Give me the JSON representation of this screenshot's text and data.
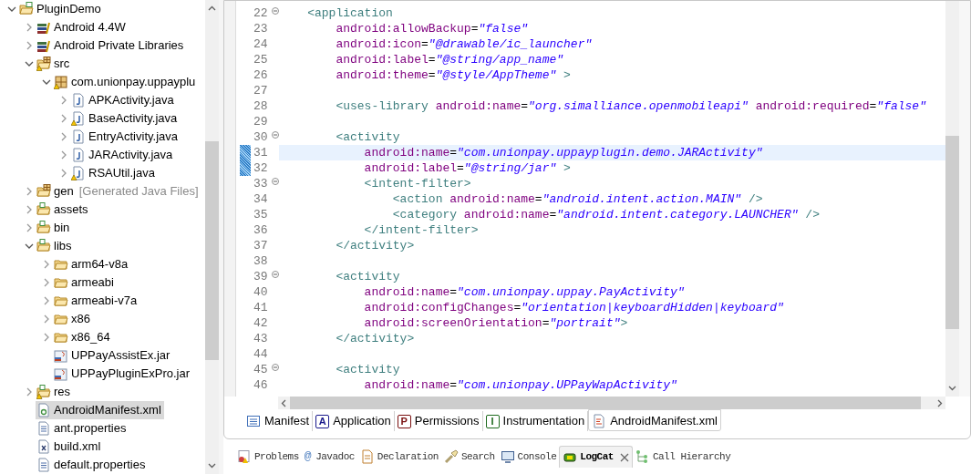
{
  "project_tree": [
    {
      "label": "PluginDemo",
      "kind": "project",
      "warning": false,
      "expanded": true,
      "selected": false,
      "children": [
        {
          "label": "Android 4.4W",
          "kind": "library",
          "warning": false,
          "expanded": false,
          "selected": false
        },
        {
          "label": "Android Private Libraries",
          "kind": "library",
          "warning": false,
          "expanded": false,
          "selected": false
        },
        {
          "label": "src",
          "kind": "source-folder",
          "warning": true,
          "expanded": true,
          "selected": false,
          "children": [
            {
              "label": "com.unionpay.uppayplu",
              "kind": "package",
              "warning": true,
              "expanded": true,
              "selected": false,
              "children": [
                {
                  "label": "APKActivity.java",
                  "kind": "java",
                  "warning": false,
                  "expanded": false,
                  "selected": false
                },
                {
                  "label": "BaseActivity.java",
                  "kind": "java",
                  "warning": true,
                  "expanded": false,
                  "selected": false
                },
                {
                  "label": "EntryActivity.java",
                  "kind": "java",
                  "warning": false,
                  "expanded": false,
                  "selected": false
                },
                {
                  "label": "JARActivity.java",
                  "kind": "java",
                  "warning": false,
                  "expanded": false,
                  "selected": false
                },
                {
                  "label": "RSAUtil.java",
                  "kind": "java",
                  "warning": true,
                  "expanded": false,
                  "selected": false
                }
              ]
            }
          ]
        },
        {
          "label": "gen",
          "suffix": "[Generated Java Files]",
          "kind": "source-folder",
          "warning": false,
          "expanded": false,
          "selected": false
        },
        {
          "label": "assets",
          "kind": "folder-green",
          "warning": false,
          "expanded": false,
          "selected": false
        },
        {
          "label": "bin",
          "kind": "folder-green",
          "warning": false,
          "expanded": false,
          "selected": false
        },
        {
          "label": "libs",
          "kind": "folder-green",
          "warning": false,
          "expanded": true,
          "selected": false,
          "children": [
            {
              "label": "arm64-v8a",
              "kind": "folder",
              "warning": false,
              "expanded": false,
              "selected": false
            },
            {
              "label": "armeabi",
              "kind": "folder",
              "warning": false,
              "expanded": false,
              "selected": false
            },
            {
              "label": "armeabi-v7a",
              "kind": "folder",
              "warning": false,
              "expanded": false,
              "selected": false
            },
            {
              "label": "x86",
              "kind": "folder",
              "warning": false,
              "expanded": false,
              "selected": false
            },
            {
              "label": "x86_64",
              "kind": "folder",
              "warning": false,
              "expanded": false,
              "selected": false
            },
            {
              "label": "UPPayAssistEx.jar",
              "kind": "jar",
              "warning": false,
              "selected": false
            },
            {
              "label": "UPPayPluginExPro.jar",
              "kind": "jar",
              "warning": false,
              "selected": false
            }
          ]
        },
        {
          "label": "res",
          "kind": "folder-green",
          "warning": true,
          "expanded": false,
          "selected": false
        },
        {
          "label": "AndroidManifest.xml",
          "kind": "manifest",
          "warning": false,
          "selected": true
        },
        {
          "label": "ant.properties",
          "kind": "properties",
          "warning": false,
          "selected": false
        },
        {
          "label": "build.xml",
          "kind": "xml",
          "warning": false,
          "selected": false
        },
        {
          "label": "default.properties",
          "kind": "properties",
          "warning": false,
          "selected": false
        }
      ]
    }
  ],
  "editor": {
    "lines": [
      {
        "number": "22",
        "fold": true,
        "changed": false,
        "current": false,
        "tokens": [
          {
            "kind": "tag",
            "text": "    <application"
          }
        ]
      },
      {
        "number": "23",
        "fold": false,
        "changed": false,
        "current": false,
        "tokens": [
          {
            "kind": "attr",
            "text": "        android:allowBackup"
          },
          {
            "kind": "punct",
            "text": "="
          },
          {
            "kind": "value",
            "text": "\"false\""
          }
        ]
      },
      {
        "number": "24",
        "fold": false,
        "changed": false,
        "current": false,
        "tokens": [
          {
            "kind": "attr",
            "text": "        android:icon"
          },
          {
            "kind": "punct",
            "text": "="
          },
          {
            "kind": "value",
            "text": "\"@drawable/ic_launcher\""
          }
        ]
      },
      {
        "number": "25",
        "fold": false,
        "changed": false,
        "current": false,
        "tokens": [
          {
            "kind": "attr",
            "text": "        android:label"
          },
          {
            "kind": "punct",
            "text": "="
          },
          {
            "kind": "value",
            "text": "\"@string/app_name\""
          }
        ]
      },
      {
        "number": "26",
        "fold": false,
        "changed": false,
        "current": false,
        "tokens": [
          {
            "kind": "attr",
            "text": "        android:theme"
          },
          {
            "kind": "punct",
            "text": "="
          },
          {
            "kind": "value",
            "text": "\"@style/AppTheme\""
          },
          {
            "kind": "tag",
            "text": " >"
          }
        ]
      },
      {
        "number": "27",
        "fold": false,
        "changed": false,
        "current": false
      },
      {
        "number": "28",
        "fold": false,
        "changed": false,
        "current": false,
        "tokens": [
          {
            "kind": "tag",
            "text": "        <uses-library"
          },
          {
            "kind": "attr",
            "text": " android:name"
          },
          {
            "kind": "punct",
            "text": "="
          },
          {
            "kind": "value",
            "text": "\"org.simalliance.openmobileapi\""
          },
          {
            "kind": "attr",
            "text": " android:required"
          },
          {
            "kind": "punct",
            "text": "="
          },
          {
            "kind": "value",
            "text": "\"false\""
          }
        ]
      },
      {
        "number": "29",
        "fold": false,
        "changed": false,
        "current": false
      },
      {
        "number": "30",
        "fold": true,
        "changed": false,
        "current": false,
        "tokens": [
          {
            "kind": "tag",
            "text": "        <activity"
          }
        ]
      },
      {
        "number": "31",
        "fold": false,
        "changed": true,
        "current": true,
        "tokens": [
          {
            "kind": "attr",
            "text": "            android:name"
          },
          {
            "kind": "punct",
            "text": "="
          },
          {
            "kind": "value",
            "text": "\"com.unionpay.uppayplugin.demo.JARActivity\""
          }
        ]
      },
      {
        "number": "32",
        "fold": false,
        "changed": true,
        "current": false,
        "tokens": [
          {
            "kind": "attr",
            "text": "            android:label"
          },
          {
            "kind": "punct",
            "text": "="
          },
          {
            "kind": "value",
            "text": "\"@string/jar\""
          },
          {
            "kind": "tag",
            "text": " >"
          }
        ]
      },
      {
        "number": "33",
        "fold": true,
        "changed": false,
        "current": false,
        "tokens": [
          {
            "kind": "tag",
            "text": "            <intent-filter>"
          }
        ]
      },
      {
        "number": "34",
        "fold": false,
        "changed": false,
        "current": false,
        "tokens": [
          {
            "kind": "tag",
            "text": "                <action"
          },
          {
            "kind": "attr",
            "text": " android:name"
          },
          {
            "kind": "punct",
            "text": "="
          },
          {
            "kind": "value",
            "text": "\"android.intent.action.MAIN\""
          },
          {
            "kind": "tag",
            "text": " />"
          }
        ]
      },
      {
        "number": "35",
        "fold": false,
        "changed": false,
        "current": false,
        "tokens": [
          {
            "kind": "tag",
            "text": "                <category"
          },
          {
            "kind": "attr",
            "text": " android:name"
          },
          {
            "kind": "punct",
            "text": "="
          },
          {
            "kind": "value",
            "text": "\"android.intent.category.LAUNCHER\""
          },
          {
            "kind": "tag",
            "text": " />"
          }
        ]
      },
      {
        "number": "36",
        "fold": false,
        "changed": false,
        "current": false,
        "tokens": [
          {
            "kind": "tag",
            "text": "            </intent-filter>"
          }
        ]
      },
      {
        "number": "37",
        "fold": false,
        "changed": false,
        "current": false,
        "tokens": [
          {
            "kind": "tag",
            "text": "        </activity>"
          }
        ]
      },
      {
        "number": "38",
        "fold": false,
        "changed": false,
        "current": false
      },
      {
        "number": "39",
        "fold": true,
        "changed": false,
        "current": false,
        "tokens": [
          {
            "kind": "tag",
            "text": "        <activity"
          }
        ]
      },
      {
        "number": "40",
        "fold": false,
        "changed": false,
        "current": false,
        "tokens": [
          {
            "kind": "attr",
            "text": "            android:name"
          },
          {
            "kind": "punct",
            "text": "="
          },
          {
            "kind": "value",
            "text": "\"com.unionpay.uppay.PayActivity\""
          }
        ]
      },
      {
        "number": "41",
        "fold": false,
        "changed": false,
        "current": false,
        "tokens": [
          {
            "kind": "attr",
            "text": "            android:configChanges"
          },
          {
            "kind": "punct",
            "text": "="
          },
          {
            "kind": "value",
            "text": "\"orientation|keyboardHidden|keyboard\""
          }
        ]
      },
      {
        "number": "42",
        "fold": false,
        "changed": false,
        "current": false,
        "tokens": [
          {
            "kind": "attr",
            "text": "            android:screenOrientation"
          },
          {
            "kind": "punct",
            "text": "="
          },
          {
            "kind": "value",
            "text": "\"portrait\""
          },
          {
            "kind": "tag",
            "text": ">"
          }
        ]
      },
      {
        "number": "43",
        "fold": false,
        "changed": false,
        "current": false,
        "tokens": [
          {
            "kind": "tag",
            "text": "        </activity>"
          }
        ]
      },
      {
        "number": "44",
        "fold": false,
        "changed": false,
        "current": false
      },
      {
        "number": "45",
        "fold": true,
        "changed": false,
        "current": false,
        "tokens": [
          {
            "kind": "tag",
            "text": "        <activity"
          }
        ]
      },
      {
        "number": "46",
        "fold": false,
        "changed": false,
        "current": false,
        "tokens": [
          {
            "kind": "attr",
            "text": "            android:name"
          },
          {
            "kind": "punct",
            "text": "="
          },
          {
            "kind": "value",
            "text": "\"com.unionpay.UPPayWapActivity\""
          }
        ]
      }
    ]
  },
  "editor_tabs": [
    {
      "label": "Manifest",
      "kind": "overview",
      "selected": false
    },
    {
      "label": "Application",
      "kind": "letter",
      "badge": "A",
      "color": "#1a1a8c",
      "selected": false
    },
    {
      "label": "Permissions",
      "kind": "letter",
      "badge": "P",
      "color": "#7a1010",
      "selected": false
    },
    {
      "label": "Instrumentation",
      "kind": "letter",
      "badge": "I",
      "color": "#1f6b1f",
      "selected": false
    },
    {
      "label": "AndroidManifest.xml",
      "kind": "xml",
      "selected": true
    }
  ],
  "view_tabs": [
    {
      "label": "Problems",
      "kind": "problems",
      "selected": false
    },
    {
      "label": "Javadoc",
      "kind": "char",
      "icon_char": "@",
      "selected": false
    },
    {
      "label": "Declaration",
      "kind": "declaration",
      "selected": false
    },
    {
      "label": "Search",
      "kind": "search",
      "selected": false
    },
    {
      "label": "Console",
      "kind": "console",
      "selected": false
    },
    {
      "label": "LogCat",
      "kind": "logcat",
      "selected": true,
      "closable": true
    },
    {
      "label": "Call Hierarchy",
      "kind": "hierarchy",
      "selected": false
    }
  ]
}
